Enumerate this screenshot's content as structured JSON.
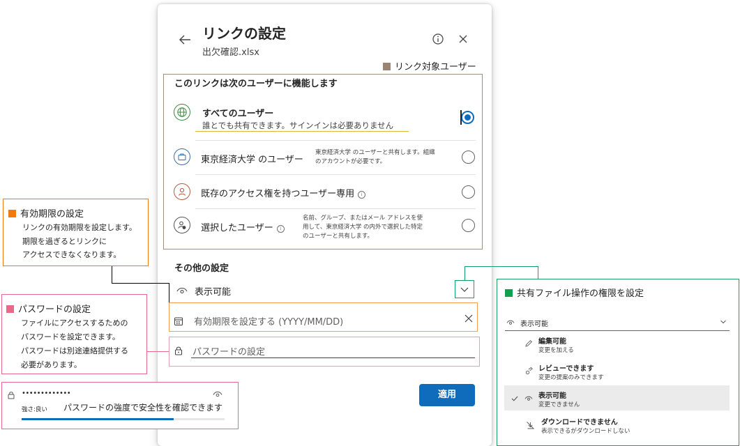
{
  "dialog": {
    "title": "リンクの設定",
    "subtitle": "出欠確認.xlsx",
    "section_head": "このリンクは次のユーザーに機能します",
    "options": [
      {
        "label": "すべてのユーザー",
        "desc": "誰とでも共有できます。サインインは必要ありません",
        "selected": true,
        "icon": "globe-icon"
      },
      {
        "label": "東京経済大学 のユーザー",
        "desc_lines": [
          "東京経済大学 のユーザーと共有します。組織",
          "のアカウントが必要です。"
        ],
        "selected": false,
        "icon": "briefcase-icon"
      },
      {
        "label": "既存のアクセス権を持つユーザー専用",
        "selected": false,
        "icon": "person-icon"
      },
      {
        "label": "選択したユーザー",
        "desc_lines": [
          "名前、グループ、またはメール アドレスを使",
          "用して、東京経済大学 の内外で選択した特定",
          "のユーザーと共有します。"
        ],
        "selected": false,
        "icon": "person-settings-icon"
      }
    ],
    "other_head": "その他の設定",
    "permission_value": "表示可能",
    "expiry_placeholder": "有効期限を設定する (YYYY/MM/DD)",
    "password_placeholder": "パスワードの設定",
    "apply_label": "適用"
  },
  "legend_link_target": {
    "text": "リンク対象ユーザー",
    "color": "#9b8473"
  },
  "callout_expiry": {
    "title": "有効期限の設定",
    "color": "#f07a10",
    "lines": [
      "リンクの有効期限を設定します。",
      "期限を過ぎるとリンクに",
      "アクセスできなくなります。"
    ]
  },
  "callout_password": {
    "title": "パスワードの設定",
    "color": "#e86a8a",
    "lines": [
      "ファイルにアクセスするための",
      "パスワードを設定できます。",
      "パスワードは別途連絡提供する",
      "必要があります。"
    ]
  },
  "callout_strength": {
    "dots": "•••••••••••••",
    "strength_label": "強さ:良い",
    "caption": "パスワードの強度で安全性を確認できます",
    "strength_fraction": 0.75,
    "color": "#e86a8a"
  },
  "callout_permission": {
    "title": "共有ファイル操作の権限を設定",
    "color": "#10a050",
    "current": "表示可能",
    "items": [
      {
        "title": "編集可能",
        "sub": "変更を加える",
        "icon": "pencil-icon",
        "selected": false
      },
      {
        "title": "レビューできます",
        "sub": "変更の提案のみできます",
        "icon": "review-icon",
        "selected": false
      },
      {
        "title": "表示可能",
        "sub": "変更できません",
        "icon": "eye-icon",
        "selected": true
      },
      {
        "title": "ダウンロードできません",
        "sub": "表示できるがダウンロードしない",
        "icon": "no-download-icon",
        "selected": false
      }
    ]
  }
}
